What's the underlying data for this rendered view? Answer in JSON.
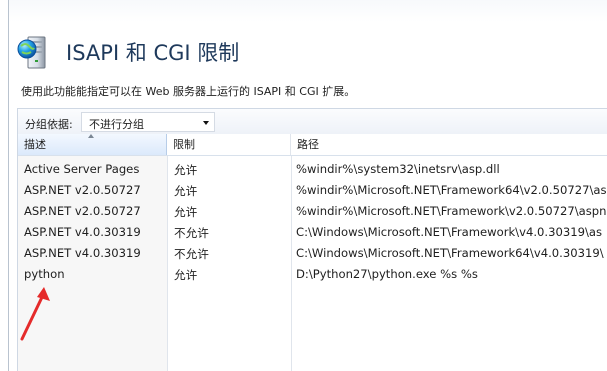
{
  "window": {
    "title": "ISAPI 和 CGI 限制",
    "description": "使用此功能能指定可以在 Web 服务器上运行的 ISAPI 和 CGI 扩展。"
  },
  "toolbar": {
    "group_label": "分组依据:",
    "group_value": "不进行分组"
  },
  "table": {
    "headers": [
      "描述",
      "限制",
      "路径"
    ],
    "rows": [
      {
        "description": "Active Server Pages",
        "restriction": "允许",
        "path": "%windir%\\system32\\inetsrv\\asp.dll"
      },
      {
        "description": "ASP.NET v2.0.50727",
        "restriction": "允许",
        "path": "%windir%\\Microsoft.NET\\Framework64\\v2.0.50727\\as"
      },
      {
        "description": "ASP.NET v2.0.50727",
        "restriction": "允许",
        "path": "%windir%\\Microsoft.NET\\Framework\\v2.0.50727\\aspn"
      },
      {
        "description": "ASP.NET v4.0.30319",
        "restriction": "不允许",
        "path": "C:\\Windows\\Microsoft.NET\\Framework\\v4.0.30319\\as"
      },
      {
        "description": "ASP.NET v4.0.30319",
        "restriction": "不允许",
        "path": "C:\\Windows\\Microsoft.NET\\Framework64\\v4.0.30319\\"
      },
      {
        "description": "python",
        "restriction": "允许",
        "path": "D:\\Python27\\python.exe %s %s"
      }
    ]
  },
  "icons": {
    "header": "globe-server-icon",
    "sort": "sort-ascending-icon",
    "dropdown": "chevron-down-icon",
    "annotation": "red-arrow-icon"
  },
  "colors": {
    "title": "#1e395b",
    "selected_header": "#dbe9fb",
    "annotation_arrow": "#e52b2b"
  }
}
